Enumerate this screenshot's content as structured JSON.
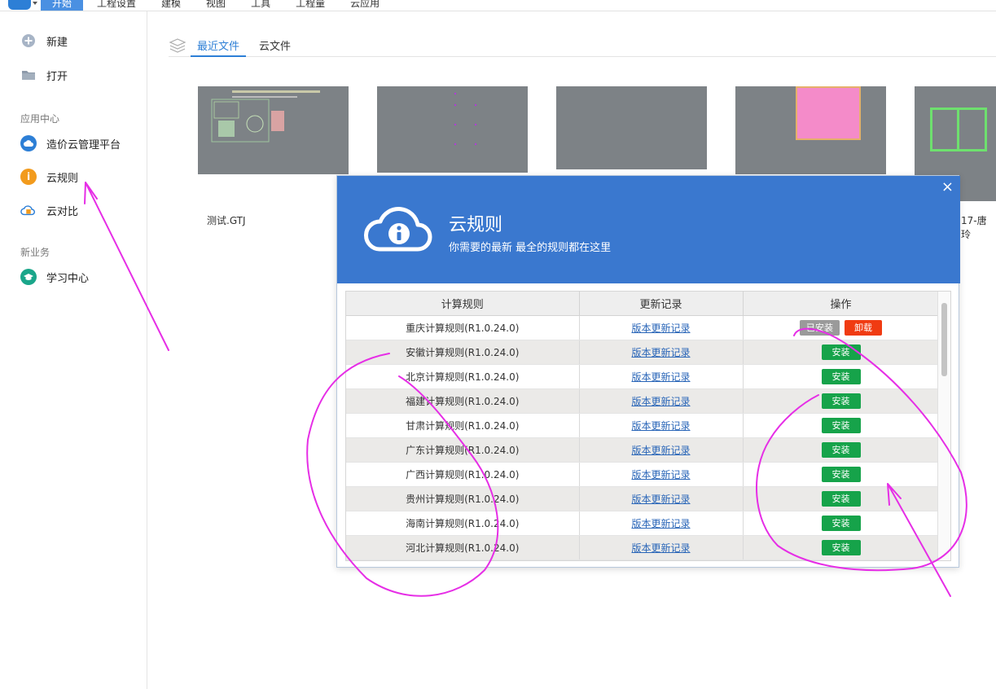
{
  "menu": {
    "items": [
      {
        "label": "开始",
        "active": true
      },
      {
        "label": "工程设置",
        "active": false
      },
      {
        "label": "建模",
        "active": false
      },
      {
        "label": "视图",
        "active": false
      },
      {
        "label": "工具",
        "active": false
      },
      {
        "label": "工程量",
        "active": false
      },
      {
        "label": "云应用",
        "active": false
      }
    ]
  },
  "sidebar": {
    "new_label": "新建",
    "open_label": "打开",
    "section_app_center": "应用中心",
    "cloud_platform_label": "造价云管理平台",
    "cloud_rules_label": "云规则",
    "cloud_compare_label": "云对比",
    "section_new_business": "新业务",
    "learning_center_label": "学习中心"
  },
  "tabs": {
    "recent": "最近文件",
    "cloud": "云文件"
  },
  "files": {
    "first_name": "测试.GTJ",
    "last_name_partial": "17-唐玲"
  },
  "dialog": {
    "close_glyph": "×",
    "title": "云规则",
    "subtitle": "你需要的最新 最全的规则都在这里",
    "columns": [
      "计算规则",
      "更新记录",
      "操作"
    ],
    "rows": [
      {
        "rule": "重庆计算规则(R1.0.24.0)",
        "log": "版本更新记录",
        "installed": true
      },
      {
        "rule": "安徽计算规则(R1.0.24.0)",
        "log": "版本更新记录",
        "installed": false
      },
      {
        "rule": "北京计算规则(R1.0.24.0)",
        "log": "版本更新记录",
        "installed": false
      },
      {
        "rule": "福建计算规则(R1.0.24.0)",
        "log": "版本更新记录",
        "installed": false
      },
      {
        "rule": "甘肃计算规则(R1.0.24.0)",
        "log": "版本更新记录",
        "installed": false
      },
      {
        "rule": "广东计算规则(R1.0.24.0)",
        "log": "版本更新记录",
        "installed": false
      },
      {
        "rule": "广西计算规则(R1.0.24.0)",
        "log": "版本更新记录",
        "installed": false
      },
      {
        "rule": "贵州计算规则(R1.0.24.0)",
        "log": "版本更新记录",
        "installed": false
      },
      {
        "rule": "海南计算规则(R1.0.24.0)",
        "log": "版本更新记录",
        "installed": false
      },
      {
        "rule": "河北计算规则(R1.0.24.0)",
        "log": "版本更新记录",
        "installed": false
      }
    ],
    "install_label": "安装",
    "installed_label": "已安装",
    "uninstall_label": "卸载"
  },
  "colors": {
    "accent": "#2d7fd6",
    "dialog_header": "#3a78cf",
    "install_green": "#16a34a",
    "uninstall_red": "#f03b12",
    "annotation_magenta": "#e62ee6"
  }
}
